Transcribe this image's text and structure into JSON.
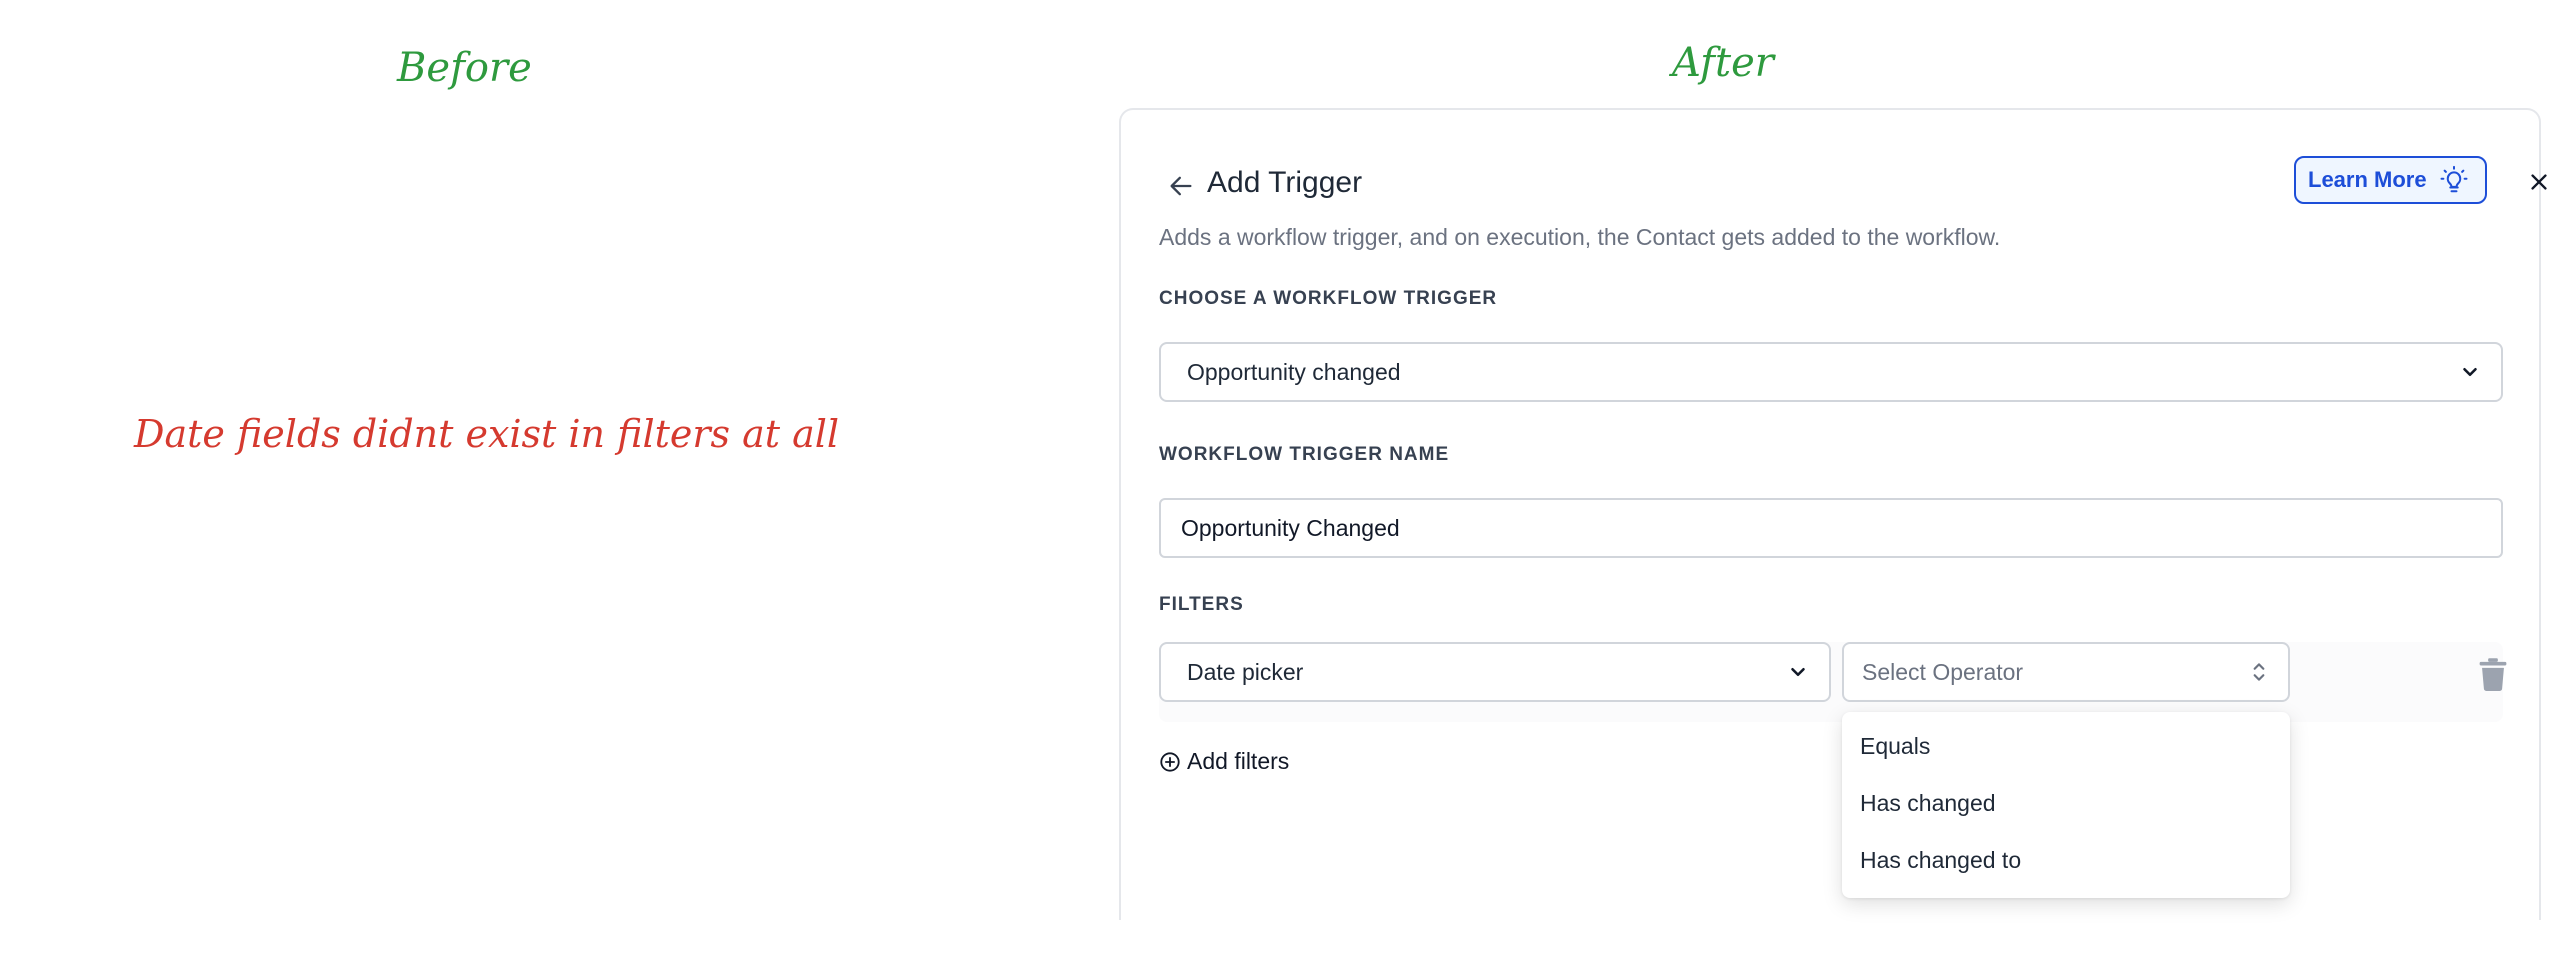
{
  "annotations": {
    "before": "Before",
    "after": "After",
    "note": "Date fields didnt exist in filters at all"
  },
  "panel": {
    "title": "Add Trigger",
    "learn_more": "Learn More",
    "description": "Adds a workflow trigger, and on execution, the Contact gets added to the workflow.",
    "trigger_section_label": "CHOOSE A WORKFLOW TRIGGER",
    "trigger_value": "Opportunity changed",
    "name_section_label": "WORKFLOW TRIGGER NAME",
    "name_value": "Opportunity Changed",
    "filters_label": "FILTERS",
    "filter_field_value": "Date picker",
    "operator_placeholder": "Select Operator",
    "operator_options": [
      "Equals",
      "Has changed",
      "Has changed to"
    ],
    "add_filters": "Add filters"
  },
  "icons": {
    "back": "arrow-left-icon",
    "learn_more": "lightbulb-icon",
    "close": "close-icon",
    "chevron": "chevron-down-icon",
    "sort": "chevron-up-down-icon",
    "trash": "trash-icon",
    "add": "plus-circle-icon"
  },
  "colors": {
    "annotation_green": "#2e9a3e",
    "annotation_red": "#d53a2f",
    "accent_blue": "#1d4ed8"
  }
}
